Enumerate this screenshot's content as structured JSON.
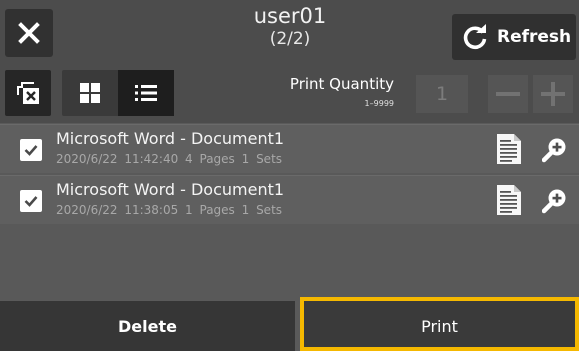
{
  "header": {
    "user": "user01",
    "page_count": "(2/2)",
    "refresh_label": "Refresh"
  },
  "toolbar": {
    "quantity_label": "Print Quantity",
    "quantity_range": "1–9999",
    "quantity_value": "1",
    "minus_label": "−",
    "plus_label": "+",
    "active_view": "list"
  },
  "jobs": [
    {
      "name": "Microsoft Word - Document1",
      "meta": "2020/6/22 11:42:40  4 Pages  1 Sets",
      "checked": true
    },
    {
      "name": "Microsoft Word - Document1",
      "meta": "2020/6/22 11:38:05  1 Pages  1 Sets",
      "checked": true
    }
  ],
  "actions": {
    "delete_label": "Delete",
    "print_label": "Print"
  },
  "colors": {
    "focus_border": "#f5b800",
    "background": "#5a5a5a",
    "button_dark": "#363636"
  },
  "icons": [
    "close-icon",
    "refresh-icon",
    "deselect-icon",
    "grid-view-icon",
    "list-view-icon",
    "document-icon",
    "zoom-in-icon",
    "checkmark-icon"
  ]
}
